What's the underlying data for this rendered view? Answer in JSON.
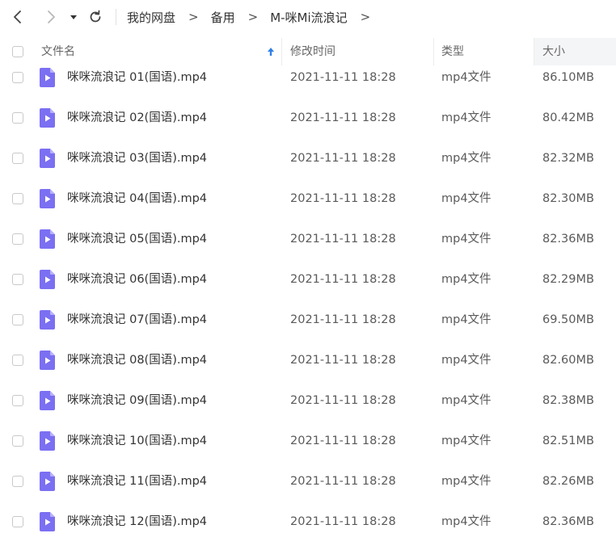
{
  "nav": {
    "back_icon": "chevron-left-icon",
    "forward_icon": "chevron-right-icon",
    "history_icon": "caret-down-icon",
    "refresh_icon": "refresh-icon"
  },
  "breadcrumb": {
    "items": [
      "我的网盘",
      "备用",
      "M-咪Mi流浪记"
    ],
    "separator": ">"
  },
  "columns": {
    "name": "文件名",
    "modified": "修改时间",
    "type": "类型",
    "size": "大小"
  },
  "sort": {
    "icon": "sort-ascending-icon",
    "color": "#2f7fe8"
  },
  "file_icon": {
    "name": "video-file-icon",
    "color": "#7b6ff2"
  },
  "files": [
    {
      "name": "咪咪流浪记 01(国语).mp4",
      "modified": "2021-11-11 18:28",
      "type": "mp4文件",
      "size": "86.10MB"
    },
    {
      "name": "咪咪流浪记 02(国语).mp4",
      "modified": "2021-11-11 18:28",
      "type": "mp4文件",
      "size": "80.42MB"
    },
    {
      "name": "咪咪流浪记 03(国语).mp4",
      "modified": "2021-11-11 18:28",
      "type": "mp4文件",
      "size": "82.32MB"
    },
    {
      "name": "咪咪流浪记 04(国语).mp4",
      "modified": "2021-11-11 18:28",
      "type": "mp4文件",
      "size": "82.30MB"
    },
    {
      "name": "咪咪流浪记 05(国语).mp4",
      "modified": "2021-11-11 18:28",
      "type": "mp4文件",
      "size": "82.36MB"
    },
    {
      "name": "咪咪流浪记 06(国语).mp4",
      "modified": "2021-11-11 18:28",
      "type": "mp4文件",
      "size": "82.29MB"
    },
    {
      "name": "咪咪流浪记 07(国语).mp4",
      "modified": "2021-11-11 18:28",
      "type": "mp4文件",
      "size": "69.50MB"
    },
    {
      "name": "咪咪流浪记 08(国语).mp4",
      "modified": "2021-11-11 18:28",
      "type": "mp4文件",
      "size": "82.60MB"
    },
    {
      "name": "咪咪流浪记 09(国语).mp4",
      "modified": "2021-11-11 18:28",
      "type": "mp4文件",
      "size": "82.38MB"
    },
    {
      "name": "咪咪流浪记 10(国语).mp4",
      "modified": "2021-11-11 18:28",
      "type": "mp4文件",
      "size": "82.51MB"
    },
    {
      "name": "咪咪流浪记 11(国语).mp4",
      "modified": "2021-11-11 18:28",
      "type": "mp4文件",
      "size": "82.26MB"
    },
    {
      "name": "咪咪流浪记 12(国语).mp4",
      "modified": "2021-11-11 18:28",
      "type": "mp4文件",
      "size": "82.36MB"
    }
  ]
}
